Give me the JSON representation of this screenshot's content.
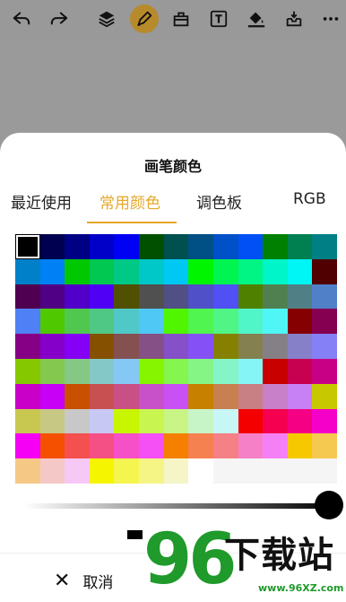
{
  "toolbar": {
    "icons": [
      "undo-icon",
      "redo-icon",
      "layers-icon",
      "brush-icon",
      "eraser-icon",
      "text-icon",
      "fill-bucket-icon",
      "save-icon",
      "more-icon"
    ],
    "active": "brush-icon",
    "active_color": "#b78a2c"
  },
  "sheet": {
    "title": "画笔颜色",
    "tabs": [
      {
        "label": "最近使用"
      },
      {
        "label": "常用颜色"
      },
      {
        "label": "调色板"
      },
      {
        "label": "RGB"
      }
    ],
    "active_tab": "常用颜色",
    "accent": "#e6a82a"
  },
  "palette": {
    "selected": "#000000",
    "rows": [
      [
        "#000000",
        "#000050",
        "#000085",
        "#0000c8",
        "#0000f5",
        "#005000",
        "#005050",
        "#005085",
        "#0050c8",
        "#0050f5",
        "#008000",
        "#008050",
        "#008085"
      ],
      [
        "#0080c8",
        "#0080f5",
        "#00c800",
        "#00c850",
        "#00c885",
        "#00c8c8",
        "#00c8f5",
        "#00f500",
        "#00f550",
        "#00f585",
        "#00f5c8",
        "#00f5f5",
        "#500000"
      ],
      [
        "#500050",
        "#500085",
        "#5000c8",
        "#5000f5",
        "#505000",
        "#505050",
        "#505085",
        "#5050c8",
        "#5050f5",
        "#508000",
        "#508050",
        "#508085",
        "#5080c8"
      ],
      [
        "#5080f5",
        "#50c800",
        "#50c850",
        "#50c885",
        "#50c8c8",
        "#50c8f5",
        "#50f500",
        "#50f550",
        "#50f585",
        "#50f5c8",
        "#50f5f5",
        "#850000",
        "#850050"
      ],
      [
        "#850085",
        "#8500c8",
        "#8500f5",
        "#855000",
        "#855050",
        "#855085",
        "#8550c8",
        "#8550f5",
        "#858000",
        "#858050",
        "#858085",
        "#8580c8",
        "#8580f5"
      ],
      [
        "#85c800",
        "#85c850",
        "#85c885",
        "#85c8c8",
        "#85c8f5",
        "#85f500",
        "#85f550",
        "#85f585",
        "#85f5c8",
        "#85f5f5",
        "#c80000",
        "#c80050",
        "#c80085"
      ],
      [
        "#c800c8",
        "#c800f5",
        "#c85000",
        "#c85050",
        "#c85085",
        "#c850c8",
        "#c850f5",
        "#c88000",
        "#c88050",
        "#c88085",
        "#c880c8",
        "#c880f5",
        "#c8c800"
      ],
      [
        "#c8c850",
        "#c8c885",
        "#c8c8c8",
        "#c8c8f5",
        "#c8f500",
        "#c8f550",
        "#c8f585",
        "#c8f5c8",
        "#c8f5f5",
        "#f50000",
        "#f50050",
        "#f50085",
        "#f500c8"
      ],
      [
        "#f500f5",
        "#f55000",
        "#f55050",
        "#f55085",
        "#f550c8",
        "#f550f5",
        "#f58000",
        "#f58050",
        "#f58085",
        "#f580c8",
        "#f580f5",
        "#f5c800",
        "#f5c850"
      ],
      [
        "#f5c885",
        "#f5c8c8",
        "#f5c8f5",
        "#f5f500",
        "#f5f550",
        "#f5f585",
        "#f5f5c8",
        "#ffffff",
        "#f5f5f5",
        "#f5f5f5",
        "#f5f5f5",
        "#f5f5f5",
        "#f5f5f5"
      ]
    ]
  },
  "opacity_level": 1.0,
  "bottom": {
    "cancel_label": "取消"
  },
  "watermark": {
    "number": "96",
    "brand": "下载站",
    "url": "www.96XZ.com"
  }
}
